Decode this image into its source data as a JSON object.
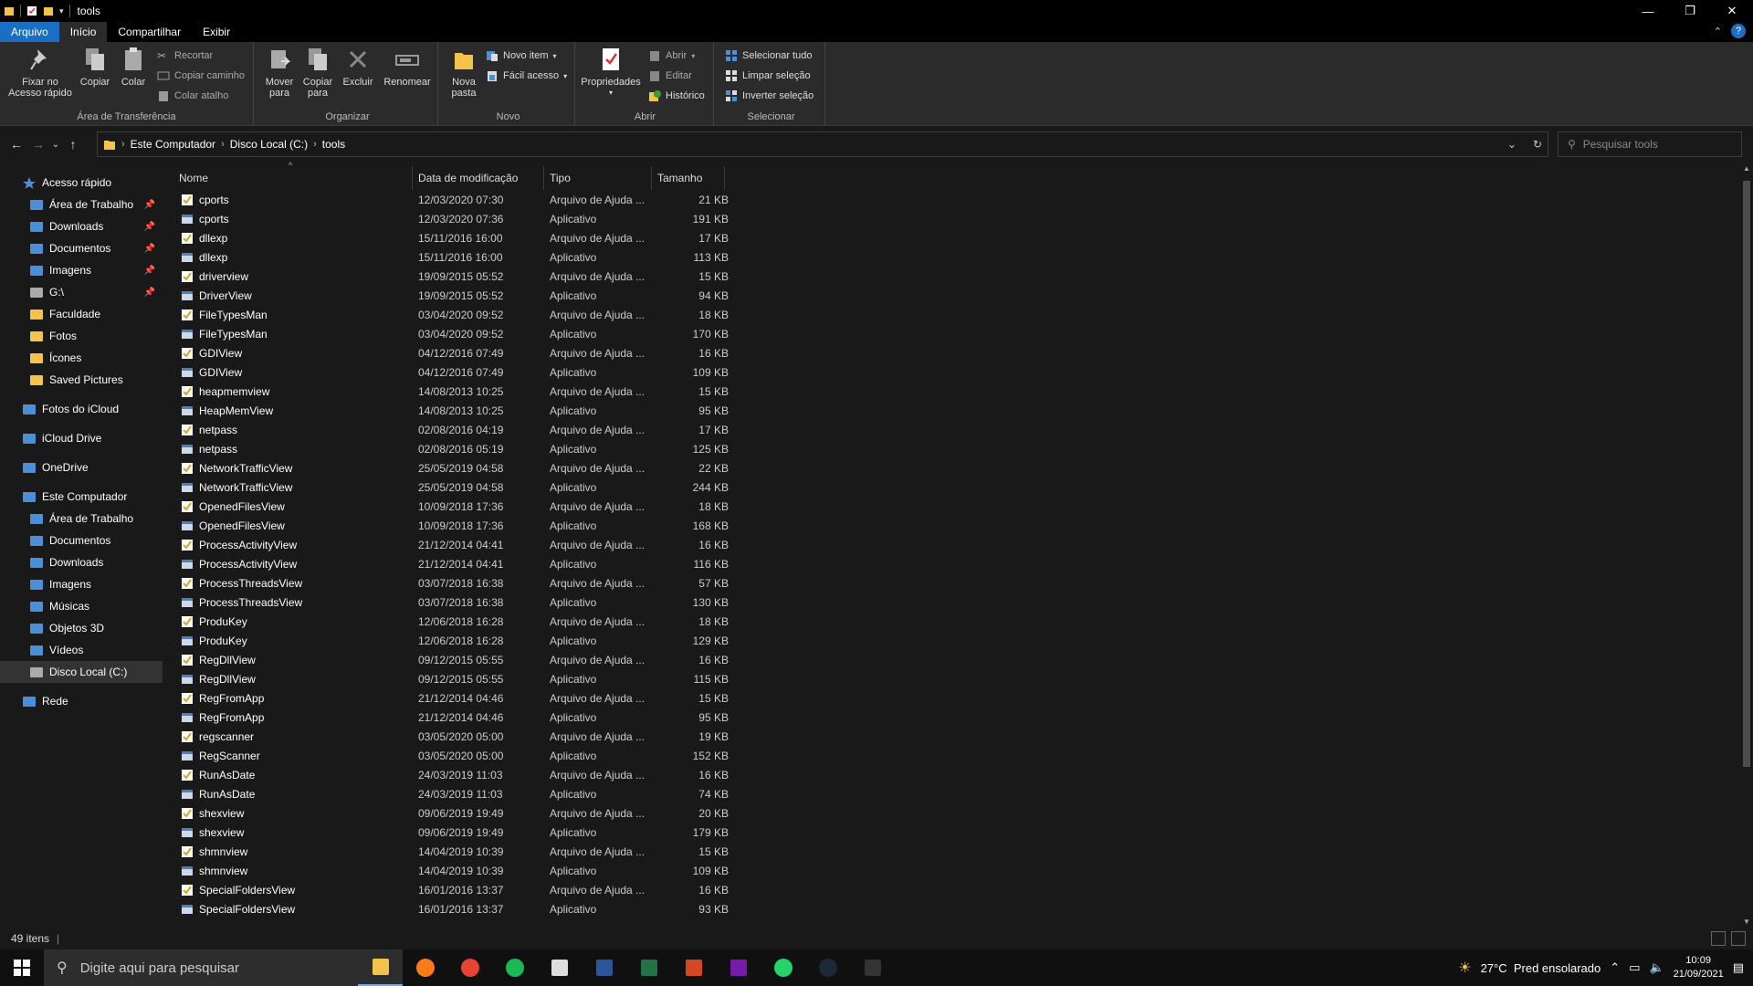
{
  "window": {
    "title": "tools",
    "controls": [
      "—",
      "❐",
      "✕"
    ]
  },
  "ribbon_tabs": [
    "Arquivo",
    "Início",
    "Compartilhar",
    "Exibir"
  ],
  "ribbon": {
    "clipboard": {
      "label": "Área de Transferência",
      "pin_quick": "Fixar no Acesso rápido",
      "copy": "Copiar",
      "paste": "Colar",
      "cut": "Recortar",
      "copy_path": "Copiar caminho",
      "paste_shortcut": "Colar atalho"
    },
    "organize": {
      "label": "Organizar",
      "move_to": "Mover para",
      "copy_to": "Copiar para",
      "delete": "Excluir",
      "rename": "Renomear"
    },
    "new": {
      "label": "Novo",
      "new_folder": "Nova pasta",
      "new_item": "Novo item",
      "easy_access": "Fácil acesso"
    },
    "open": {
      "label": "Abrir",
      "properties": "Propriedades",
      "open": "Abrir",
      "edit": "Editar",
      "history": "Histórico"
    },
    "select": {
      "label": "Selecionar",
      "select_all": "Selecionar tudo",
      "select_none": "Limpar seleção",
      "invert": "Inverter seleção"
    }
  },
  "address": {
    "crumbs": [
      "Este Computador",
      "Disco Local (C:)",
      "tools"
    ],
    "search_placeholder": "Pesquisar tools"
  },
  "nav": [
    {
      "label": "Acesso rápido",
      "icon": "star-icon",
      "pinned": false,
      "indent": 0
    },
    {
      "label": "Área de Trabalho",
      "icon": "desktop-icon",
      "pinned": true,
      "indent": 1
    },
    {
      "label": "Downloads",
      "icon": "download-icon",
      "pinned": true,
      "indent": 1
    },
    {
      "label": "Documentos",
      "icon": "document-icon",
      "pinned": true,
      "indent": 1
    },
    {
      "label": "Imagens",
      "icon": "image-icon",
      "pinned": true,
      "indent": 1
    },
    {
      "label": "G:\\",
      "icon": "drive-icon",
      "pinned": true,
      "indent": 1
    },
    {
      "label": "Faculdade",
      "icon": "folder-icon",
      "pinned": false,
      "indent": 1
    },
    {
      "label": "Fotos",
      "icon": "folder-icon",
      "pinned": false,
      "indent": 1
    },
    {
      "label": "Ícones",
      "icon": "folder-icon",
      "pinned": false,
      "indent": 1
    },
    {
      "label": "Saved Pictures",
      "icon": "folder-icon",
      "pinned": false,
      "indent": 1
    },
    {
      "label": "Fotos do iCloud",
      "icon": "icloud-photos-icon",
      "pinned": false,
      "indent": 0
    },
    {
      "label": "iCloud Drive",
      "icon": "icloud-drive-icon",
      "pinned": false,
      "indent": 0
    },
    {
      "label": "OneDrive",
      "icon": "onedrive-icon",
      "pinned": false,
      "indent": 0
    },
    {
      "label": "Este Computador",
      "icon": "computer-icon",
      "pinned": false,
      "indent": 0
    },
    {
      "label": "Área de Trabalho",
      "icon": "desktop-icon",
      "pinned": false,
      "indent": 1
    },
    {
      "label": "Documentos",
      "icon": "document-icon",
      "pinned": false,
      "indent": 1
    },
    {
      "label": "Downloads",
      "icon": "download-icon",
      "pinned": false,
      "indent": 1
    },
    {
      "label": "Imagens",
      "icon": "image-icon",
      "pinned": false,
      "indent": 1
    },
    {
      "label": "Músicas",
      "icon": "music-icon",
      "pinned": false,
      "indent": 1
    },
    {
      "label": "Objetos 3D",
      "icon": "cube-icon",
      "pinned": false,
      "indent": 1
    },
    {
      "label": "Vídeos",
      "icon": "video-icon",
      "pinned": false,
      "indent": 1
    },
    {
      "label": "Disco Local (C:)",
      "icon": "drive-icon",
      "pinned": false,
      "indent": 1,
      "selected": true
    },
    {
      "label": "Rede",
      "icon": "network-icon",
      "pinned": false,
      "indent": 0
    }
  ],
  "columns": [
    "Nome",
    "Data de modificação",
    "Tipo",
    "Tamanho"
  ],
  "files": [
    {
      "name": "cports",
      "date": "12/03/2020 07:30",
      "type": "Arquivo de Ajuda ...",
      "size": "21 KB",
      "kind": "help"
    },
    {
      "name": "cports",
      "date": "12/03/2020 07:36",
      "type": "Aplicativo",
      "size": "191 KB",
      "kind": "app"
    },
    {
      "name": "dllexp",
      "date": "15/11/2016 16:00",
      "type": "Arquivo de Ajuda ...",
      "size": "17 KB",
      "kind": "help"
    },
    {
      "name": "dllexp",
      "date": "15/11/2016 16:00",
      "type": "Aplicativo",
      "size": "113 KB",
      "kind": "app"
    },
    {
      "name": "driverview",
      "date": "19/09/2015 05:52",
      "type": "Arquivo de Ajuda ...",
      "size": "15 KB",
      "kind": "help"
    },
    {
      "name": "DriverView",
      "date": "19/09/2015 05:52",
      "type": "Aplicativo",
      "size": "94 KB",
      "kind": "app"
    },
    {
      "name": "FileTypesMan",
      "date": "03/04/2020 09:52",
      "type": "Arquivo de Ajuda ...",
      "size": "18 KB",
      "kind": "help"
    },
    {
      "name": "FileTypesMan",
      "date": "03/04/2020 09:52",
      "type": "Aplicativo",
      "size": "170 KB",
      "kind": "app"
    },
    {
      "name": "GDIView",
      "date": "04/12/2016 07:49",
      "type": "Arquivo de Ajuda ...",
      "size": "16 KB",
      "kind": "help"
    },
    {
      "name": "GDIView",
      "date": "04/12/2016 07:49",
      "type": "Aplicativo",
      "size": "109 KB",
      "kind": "app"
    },
    {
      "name": "heapmemview",
      "date": "14/08/2013 10:25",
      "type": "Arquivo de Ajuda ...",
      "size": "15 KB",
      "kind": "help"
    },
    {
      "name": "HeapMemView",
      "date": "14/08/2013 10:25",
      "type": "Aplicativo",
      "size": "95 KB",
      "kind": "app"
    },
    {
      "name": "netpass",
      "date": "02/08/2016 04:19",
      "type": "Arquivo de Ajuda ...",
      "size": "17 KB",
      "kind": "help"
    },
    {
      "name": "netpass",
      "date": "02/08/2016 05:19",
      "type": "Aplicativo",
      "size": "125 KB",
      "kind": "app"
    },
    {
      "name": "NetworkTrafficView",
      "date": "25/05/2019 04:58",
      "type": "Arquivo de Ajuda ...",
      "size": "22 KB",
      "kind": "help"
    },
    {
      "name": "NetworkTrafficView",
      "date": "25/05/2019 04:58",
      "type": "Aplicativo",
      "size": "244 KB",
      "kind": "app"
    },
    {
      "name": "OpenedFilesView",
      "date": "10/09/2018 17:36",
      "type": "Arquivo de Ajuda ...",
      "size": "18 KB",
      "kind": "help"
    },
    {
      "name": "OpenedFilesView",
      "date": "10/09/2018 17:36",
      "type": "Aplicativo",
      "size": "168 KB",
      "kind": "app"
    },
    {
      "name": "ProcessActivityView",
      "date": "21/12/2014 04:41",
      "type": "Arquivo de Ajuda ...",
      "size": "16 KB",
      "kind": "help"
    },
    {
      "name": "ProcessActivityView",
      "date": "21/12/2014 04:41",
      "type": "Aplicativo",
      "size": "116 KB",
      "kind": "app"
    },
    {
      "name": "ProcessThreadsView",
      "date": "03/07/2018 16:38",
      "type": "Arquivo de Ajuda ...",
      "size": "57 KB",
      "kind": "help"
    },
    {
      "name": "ProcessThreadsView",
      "date": "03/07/2018 16:38",
      "type": "Aplicativo",
      "size": "130 KB",
      "kind": "app"
    },
    {
      "name": "ProduKey",
      "date": "12/06/2018 16:28",
      "type": "Arquivo de Ajuda ...",
      "size": "18 KB",
      "kind": "help"
    },
    {
      "name": "ProduKey",
      "date": "12/06/2018 16:28",
      "type": "Aplicativo",
      "size": "129 KB",
      "kind": "app"
    },
    {
      "name": "RegDllView",
      "date": "09/12/2015 05:55",
      "type": "Arquivo de Ajuda ...",
      "size": "16 KB",
      "kind": "help"
    },
    {
      "name": "RegDllView",
      "date": "09/12/2015 05:55",
      "type": "Aplicativo",
      "size": "115 KB",
      "kind": "app"
    },
    {
      "name": "RegFromApp",
      "date": "21/12/2014 04:46",
      "type": "Arquivo de Ajuda ...",
      "size": "15 KB",
      "kind": "help"
    },
    {
      "name": "RegFromApp",
      "date": "21/12/2014 04:46",
      "type": "Aplicativo",
      "size": "95 KB",
      "kind": "app"
    },
    {
      "name": "regscanner",
      "date": "03/05/2020 05:00",
      "type": "Arquivo de Ajuda ...",
      "size": "19 KB",
      "kind": "help"
    },
    {
      "name": "RegScanner",
      "date": "03/05/2020 05:00",
      "type": "Aplicativo",
      "size": "152 KB",
      "kind": "app"
    },
    {
      "name": "RunAsDate",
      "date": "24/03/2019 11:03",
      "type": "Arquivo de Ajuda ...",
      "size": "16 KB",
      "kind": "help"
    },
    {
      "name": "RunAsDate",
      "date": "24/03/2019 11:03",
      "type": "Aplicativo",
      "size": "74 KB",
      "kind": "app"
    },
    {
      "name": "shexview",
      "date": "09/06/2019 19:49",
      "type": "Arquivo de Ajuda ...",
      "size": "20 KB",
      "kind": "help"
    },
    {
      "name": "shexview",
      "date": "09/06/2019 19:49",
      "type": "Aplicativo",
      "size": "179 KB",
      "kind": "app"
    },
    {
      "name": "shmnview",
      "date": "14/04/2019 10:39",
      "type": "Arquivo de Ajuda ...",
      "size": "15 KB",
      "kind": "help"
    },
    {
      "name": "shmnview",
      "date": "14/04/2019 10:39",
      "type": "Aplicativo",
      "size": "109 KB",
      "kind": "app"
    },
    {
      "name": "SpecialFoldersView",
      "date": "16/01/2016 13:37",
      "type": "Arquivo de Ajuda ...",
      "size": "16 KB",
      "kind": "help"
    },
    {
      "name": "SpecialFoldersView",
      "date": "16/01/2016 13:37",
      "type": "Aplicativo",
      "size": "93 KB",
      "kind": "app"
    }
  ],
  "status": {
    "count": "49 itens"
  },
  "taskbar": {
    "search_placeholder": "Digite aqui para pesquisar",
    "apps": [
      "explorer-icon",
      "firefox-icon",
      "chrome-icon",
      "spotify-icon",
      "store-icon",
      "word-icon",
      "excel-icon",
      "powerpoint-icon",
      "onenote-icon",
      "whatsapp-icon",
      "steam-icon",
      "epic-icon"
    ],
    "weather": "27°C  Pred ensolarado",
    "time": "10:09",
    "date": "21/09/2021"
  },
  "colors": {
    "accent": "#1a6fc4",
    "folder": "#f4c34a",
    "background": "#191919"
  }
}
